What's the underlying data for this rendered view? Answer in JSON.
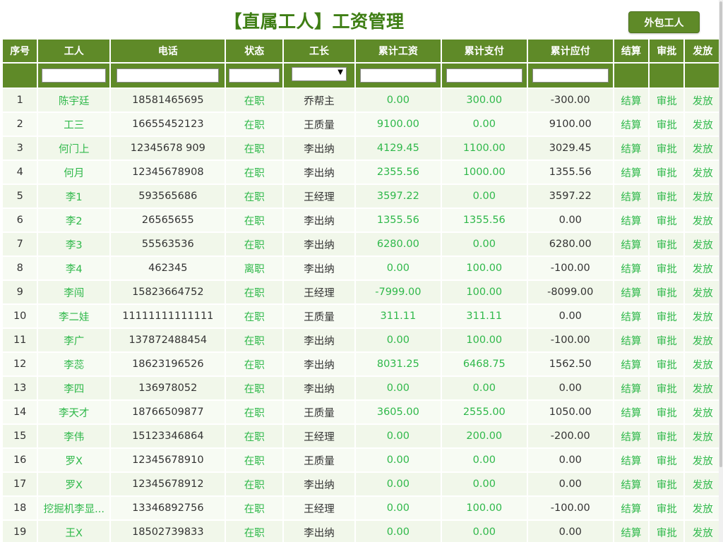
{
  "header": {
    "title": "【直属工人】工资管理",
    "outsource_button": "外包工人"
  },
  "table": {
    "columns": [
      "序号",
      "工人",
      "电话",
      "状态",
      "工长",
      "累计工资",
      "累计支付",
      "累计应付",
      "结算",
      "审批",
      "发放"
    ],
    "action_labels": {
      "settle": "结算",
      "approve": "审批",
      "issue": "发放"
    },
    "rows": [
      {
        "no": "1",
        "name": "陈宇廷",
        "phone": "18581465695",
        "status": "在职",
        "foreman": "乔帮主",
        "total_wage": "0.00",
        "total_paid": "300.00",
        "total_payable": "-300.00"
      },
      {
        "no": "2",
        "name": "工三",
        "phone": "16655452123",
        "status": "在职",
        "foreman": "王质量",
        "total_wage": "9100.00",
        "total_paid": "0.00",
        "total_payable": "9100.00"
      },
      {
        "no": "3",
        "name": "何门上",
        "phone": "12345678 909",
        "status": "在职",
        "foreman": "李出纳",
        "total_wage": "4129.45",
        "total_paid": "1100.00",
        "total_payable": "3029.45"
      },
      {
        "no": "4",
        "name": "何月",
        "phone": "12345678908",
        "status": "在职",
        "foreman": "李出纳",
        "total_wage": "2355.56",
        "total_paid": "1000.00",
        "total_payable": "1355.56"
      },
      {
        "no": "5",
        "name": "李1",
        "phone": "593565686",
        "status": "在职",
        "foreman": "王经理",
        "total_wage": "3597.22",
        "total_paid": "0.00",
        "total_payable": "3597.22"
      },
      {
        "no": "6",
        "name": "李2",
        "phone": "26565655",
        "status": "在职",
        "foreman": "李出纳",
        "total_wage": "1355.56",
        "total_paid": "1355.56",
        "total_payable": "0.00"
      },
      {
        "no": "7",
        "name": "李3",
        "phone": "55563536",
        "status": "在职",
        "foreman": "李出纳",
        "total_wage": "6280.00",
        "total_paid": "0.00",
        "total_payable": "6280.00"
      },
      {
        "no": "8",
        "name": "李4",
        "phone": "462345",
        "status": "离职",
        "foreman": "李出纳",
        "total_wage": "0.00",
        "total_paid": "100.00",
        "total_payable": "-100.00"
      },
      {
        "no": "9",
        "name": "李闯",
        "phone": "15823664752",
        "status": "在职",
        "foreman": "王经理",
        "total_wage": "-7999.00",
        "total_paid": "100.00",
        "total_payable": "-8099.00"
      },
      {
        "no": "10",
        "name": "李二娃",
        "phone": "11111111111111",
        "status": "在职",
        "foreman": "王质量",
        "total_wage": "311.11",
        "total_paid": "311.11",
        "total_payable": "0.00"
      },
      {
        "no": "11",
        "name": "李广",
        "phone": "137872488454",
        "status": "在职",
        "foreman": "李出纳",
        "total_wage": "0.00",
        "total_paid": "100.00",
        "total_payable": "-100.00"
      },
      {
        "no": "12",
        "name": "李蕊",
        "phone": "18623196526",
        "status": "在职",
        "foreman": "李出纳",
        "total_wage": "8031.25",
        "total_paid": "6468.75",
        "total_payable": "1562.50"
      },
      {
        "no": "13",
        "name": "李四",
        "phone": "136978052",
        "status": "在职",
        "foreman": "李出纳",
        "total_wage": "0.00",
        "total_paid": "0.00",
        "total_payable": "0.00"
      },
      {
        "no": "14",
        "name": "李天才",
        "phone": "18766509877",
        "status": "在职",
        "foreman": "王质量",
        "total_wage": "3605.00",
        "total_paid": "2555.00",
        "total_payable": "1050.00"
      },
      {
        "no": "15",
        "name": "李伟",
        "phone": "15123346864",
        "status": "在职",
        "foreman": "王经理",
        "total_wage": "0.00",
        "total_paid": "200.00",
        "total_payable": "-200.00"
      },
      {
        "no": "16",
        "name": "罗X",
        "phone": "12345678910",
        "status": "在职",
        "foreman": "王质量",
        "total_wage": "0.00",
        "total_paid": "0.00",
        "total_payable": "0.00"
      },
      {
        "no": "17",
        "name": "罗X",
        "phone": "12345678912",
        "status": "在职",
        "foreman": "李出纳",
        "total_wage": "0.00",
        "total_paid": "0.00",
        "total_payable": "0.00"
      },
      {
        "no": "18",
        "name": "挖掘机李显...",
        "phone": "13346892756",
        "status": "在职",
        "foreman": "王经理",
        "total_wage": "0.00",
        "total_paid": "100.00",
        "total_payable": "-100.00"
      },
      {
        "no": "19",
        "name": "王X",
        "phone": "18502739833",
        "status": "在职",
        "foreman": "李出纳",
        "total_wage": "0.00",
        "total_paid": "0.00",
        "total_payable": "0.00"
      }
    ]
  },
  "colors": {
    "header_green": "#5f8a28",
    "title_green": "#3e7e14",
    "link_green": "#2fb84a",
    "row_odd": "#f1f7ea",
    "row_even": "#f7fbf3"
  }
}
